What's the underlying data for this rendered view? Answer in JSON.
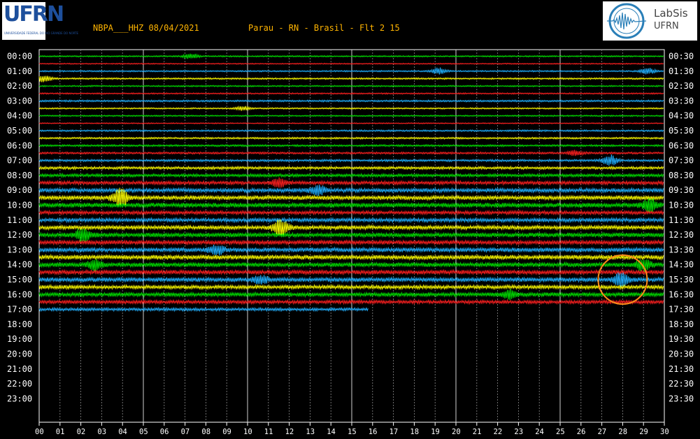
{
  "header": {
    "station_date": "NBPA___HHZ 08/04/2021",
    "location": "Parau - RN - Brasil - Flt 2 15"
  },
  "logos": {
    "left_main": "UFRN",
    "left_sub": "UNIVERSIDADE FEDERAL DO RIO GRANDE DO NORTE",
    "right_line1": "LabSis",
    "right_line2": "UFRN"
  },
  "colors": {
    "background": "#000000",
    "header_text": "#ffb400",
    "grid": "#ffffff",
    "trace_colors": [
      "#00e000",
      "#ff2020",
      "#20b0ff",
      "#ffff00"
    ],
    "annotation": "#ff8c1a"
  },
  "chart_data": {
    "type": "helicorder",
    "y_left_labels": [
      "00:00",
      "01:00",
      "02:00",
      "03:00",
      "04:00",
      "05:00",
      "06:00",
      "07:00",
      "08:00",
      "09:00",
      "10:00",
      "11:00",
      "12:00",
      "13:00",
      "14:00",
      "15:00",
      "16:00",
      "17:00",
      "18:00",
      "19:00",
      "20:00",
      "21:00",
      "22:00",
      "23:00"
    ],
    "y_right_labels": [
      "00:30",
      "01:30",
      "02:30",
      "03:30",
      "04:30",
      "05:30",
      "06:30",
      "07:30",
      "08:30",
      "09:30",
      "10:30",
      "11:30",
      "12:30",
      "13:30",
      "14:30",
      "15:30",
      "16:30",
      "17:30",
      "18:30",
      "19:30",
      "20:30",
      "21:30",
      "22:30",
      "23:30"
    ],
    "x_tick_labels": [
      "00",
      "01",
      "02",
      "03",
      "04",
      "05",
      "06",
      "07",
      "08",
      "09",
      "10",
      "11",
      "12",
      "13",
      "14",
      "15",
      "16",
      "17",
      "18",
      "19",
      "20",
      "21",
      "22",
      "23",
      "24",
      "25",
      "26",
      "27",
      "28",
      "29",
      "30"
    ],
    "x_range_minutes": [
      0,
      30
    ],
    "row_minutes": 30,
    "trace_count": 35,
    "trace_color_cycle": [
      "green",
      "red",
      "blue",
      "yellow"
    ],
    "last_trace_end_minute": 15.8,
    "noise_by_trace": [
      1,
      0.8,
      1,
      1.2,
      1,
      1,
      1.3,
      1,
      1,
      0.8,
      1.2,
      1.3,
      1.4,
      1.5,
      1.6,
      2.0,
      2.2,
      2.5,
      3.0,
      3.2,
      3.4,
      2.5,
      2.8,
      3.0,
      3.2,
      3.0,
      3.2,
      3.4,
      3.2,
      3.0,
      3.2,
      2.8,
      3.0,
      2.5,
      2.2
    ],
    "bursts": [
      {
        "trace": 0,
        "minute": 7.3,
        "amplitude": 4
      },
      {
        "trace": 2,
        "minute": 19.2,
        "amplitude": 5
      },
      {
        "trace": 2,
        "minute": 29.2,
        "amplitude": 5
      },
      {
        "trace": 3,
        "minute": 0.2,
        "amplitude": 5
      },
      {
        "trace": 7,
        "minute": 9.8,
        "amplitude": 3
      },
      {
        "trace": 13,
        "minute": 25.7,
        "amplitude": 4
      },
      {
        "trace": 14,
        "minute": 27.4,
        "amplitude": 8
      },
      {
        "trace": 17,
        "minute": 11.5,
        "amplitude": 6
      },
      {
        "trace": 18,
        "minute": 13.4,
        "amplitude": 7
      },
      {
        "trace": 19,
        "minute": 3.9,
        "amplitude": 14
      },
      {
        "trace": 20,
        "minute": 29.3,
        "amplitude": 9
      },
      {
        "trace": 23,
        "minute": 11.6,
        "amplitude": 12
      },
      {
        "trace": 24,
        "minute": 2.1,
        "amplitude": 10
      },
      {
        "trace": 26,
        "minute": 8.5,
        "amplitude": 7
      },
      {
        "trace": 28,
        "minute": 2.7,
        "amplitude": 7
      },
      {
        "trace": 28,
        "minute": 29.0,
        "amplitude": 8
      },
      {
        "trace": 30,
        "minute": 10.6,
        "amplitude": 6
      },
      {
        "trace": 30,
        "minute": 27.9,
        "amplitude": 10
      },
      {
        "trace": 32,
        "minute": 22.6,
        "amplitude": 6
      }
    ],
    "annotation_circle": {
      "trace": 30,
      "minute": 28.0
    }
  }
}
